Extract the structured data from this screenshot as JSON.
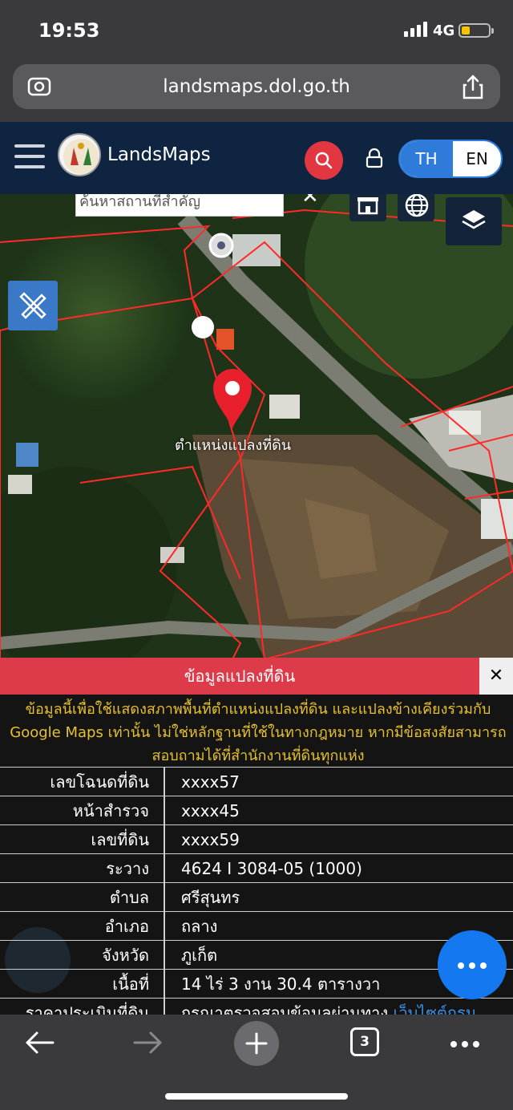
{
  "status_bar": {
    "time": "19:53",
    "network": "4G"
  },
  "browser": {
    "url": "landsmaps.dol.go.th",
    "tab_count": "3"
  },
  "app": {
    "brand": "LandsMaps",
    "lang_th": "TH",
    "lang_en": "EN"
  },
  "map": {
    "search_placeholder": "ค้นหาสถานที่สำคัญ",
    "close_symbol": "✕",
    "pin_label": "ตำแหน่งแปลงที่ดิน"
  },
  "panel": {
    "title": "ข้อมูลแปลงที่ดิน",
    "close_symbol": "✕",
    "notice": "ข้อมูลนี้เพื่อใช้แสดงสภาพพื้นที่ตำแหน่งแปลงที่ดิน และแปลงข้างเคียงร่วมกับ Google Maps เท่านั้น ไม่ใช่หลักฐานที่ใช้ในทางกฎหมาย หากมีข้อสงสัยสามารถสอบถามได้ที่สำนักงานที่ดินทุกแห่ง",
    "rows": [
      {
        "label": "เลขโฉนดที่ดิน",
        "value": "xxxx57"
      },
      {
        "label": "หน้าสำรวจ",
        "value": "xxxx45"
      },
      {
        "label": "เลขที่ดิน",
        "value": "xxxx59"
      },
      {
        "label": "ระวาง",
        "value": "4624 I 3084-05 (1000)"
      },
      {
        "label": "ตำบล",
        "value": "ศรีสุนทร"
      },
      {
        "label": "อำเภอ",
        "value": "ถลาง"
      },
      {
        "label": "จังหวัด",
        "value": "ภูเก็ต"
      },
      {
        "label": "เนื้อที่",
        "value": "14 ไร่ 3 งาน 30.4 ตารางวา"
      },
      {
        "label": "ราคาประเมินที่ดิน",
        "value": "กรุณาตรวจสอบข้อมูลผ่านทาง",
        "link": "เว็บไซต์กรม"
      }
    ]
  },
  "icons": {
    "signal": "signal-icon",
    "battery": "battery-icon",
    "scan": "scan-icon",
    "share": "share-icon",
    "menu": "hamburger-icon",
    "search": "search-icon",
    "lock": "lock-icon",
    "layers": "layers-icon",
    "tool": "ruler-pencil-icon",
    "pin": "map-pin-icon",
    "more": "more-icon"
  },
  "colors": {
    "accent_red": "#de3b4a",
    "header_navy": "#0e2440",
    "lang_blue": "#2f7bd9",
    "notice_yellow": "#e7c12c",
    "fab_blue": "#1479f0"
  }
}
